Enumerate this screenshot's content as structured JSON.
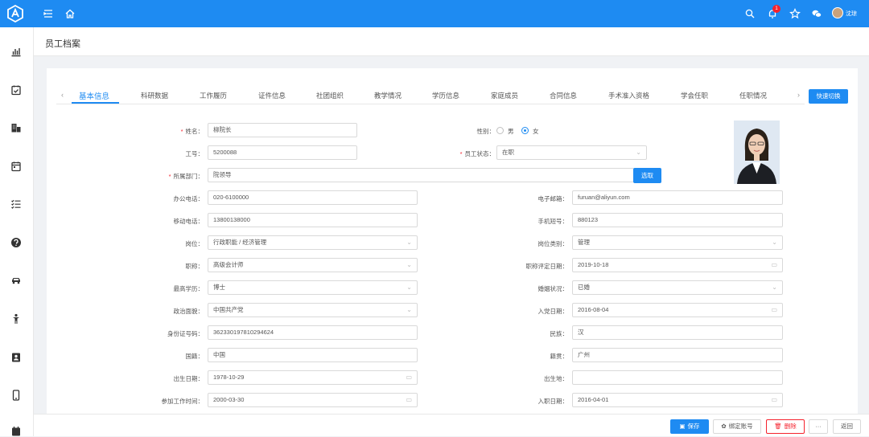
{
  "page": {
    "title": "员工档案"
  },
  "topbar": {
    "badge_count": "1",
    "username": "沈琼"
  },
  "tabs": [
    "基本信息",
    "科研数据",
    "工作履历",
    "证件信息",
    "社团组织",
    "教学情况",
    "学历信息",
    "家庭成员",
    "合同信息",
    "手术准入资格",
    "学会任职",
    "任职情况"
  ],
  "quick_switch_label": "快速切换",
  "form": {
    "name": {
      "label": "姓名",
      "value": "柳院长"
    },
    "gender": {
      "label": "性别",
      "options": [
        "男",
        "女"
      ],
      "selected": "女"
    },
    "emp_no": {
      "label": "工号",
      "value": "5200088"
    },
    "status": {
      "label": "员工状态",
      "value": "在职"
    },
    "dept": {
      "label": "所属部门",
      "value": "院领导",
      "button": "选取"
    },
    "office_phone": {
      "label": "办公电话",
      "value": "020-6100000"
    },
    "email": {
      "label": "电子邮箱",
      "value": "furuan@aliyun.com"
    },
    "mobile": {
      "label": "移动电话",
      "value": "13800138000"
    },
    "short_no": {
      "label": "手机短号",
      "value": "880123"
    },
    "post": {
      "label": "岗位",
      "value": "行政职能 / 经济管理"
    },
    "post_type": {
      "label": "岗位类别",
      "value": "管理"
    },
    "title": {
      "label": "职称",
      "value": "高级会计师"
    },
    "title_date": {
      "label": "职称评定日期",
      "value": "2019-10-18"
    },
    "education": {
      "label": "最高学历",
      "value": "博士"
    },
    "marital": {
      "label": "婚姻状况",
      "value": "已婚"
    },
    "politics": {
      "label": "政治面貌",
      "value": "中国共产党"
    },
    "party_date": {
      "label": "入党日期",
      "value": "2016-08-04"
    },
    "id_no": {
      "label": "身份证号码",
      "value": "362330197810294624"
    },
    "ethnicity": {
      "label": "民族",
      "value": "汉"
    },
    "nationality": {
      "label": "国籍",
      "value": "中国"
    },
    "native": {
      "label": "籍贯",
      "value": "广州"
    },
    "birth_date": {
      "label": "出生日期",
      "value": "1978-10-29"
    },
    "birth_place": {
      "label": "出生地",
      "value": ""
    },
    "work_date": {
      "label": "参加工作时间",
      "value": "2000-03-30"
    },
    "join_date": {
      "label": "入职日期",
      "value": "2016-04-01"
    }
  },
  "footer": {
    "save": "保存",
    "bind": "绑定账号",
    "delete": "删除",
    "more": "···",
    "back": "返回"
  },
  "colors": {
    "primary": "#1e8bf2",
    "danger": "#f5222d"
  }
}
